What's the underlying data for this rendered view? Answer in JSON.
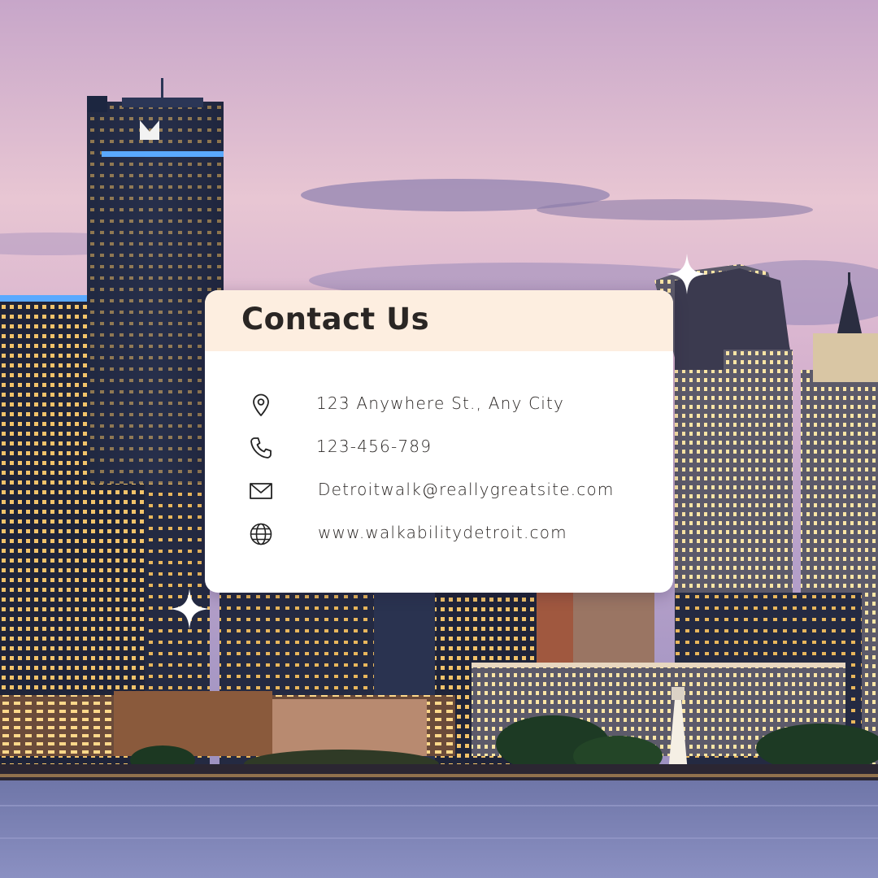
{
  "card": {
    "title": "Contact Us",
    "header_color": "#fdeee0"
  },
  "contacts": [
    {
      "icon": "location-pin-icon",
      "text": "123 Anywhere St., Any City"
    },
    {
      "icon": "phone-icon",
      "text": "123-456-789"
    },
    {
      "icon": "mail-icon",
      "text": "Detroitwalk@reallygreatsite.com"
    },
    {
      "icon": "globe-icon",
      "text": "www.walkabilitydetroit.com"
    }
  ],
  "background": {
    "scene": "city-skyline-at-dusk-icon",
    "sky_top": "#c9a3c6",
    "sky_mid": "#f0cfd6",
    "water": "#7f86b8"
  }
}
